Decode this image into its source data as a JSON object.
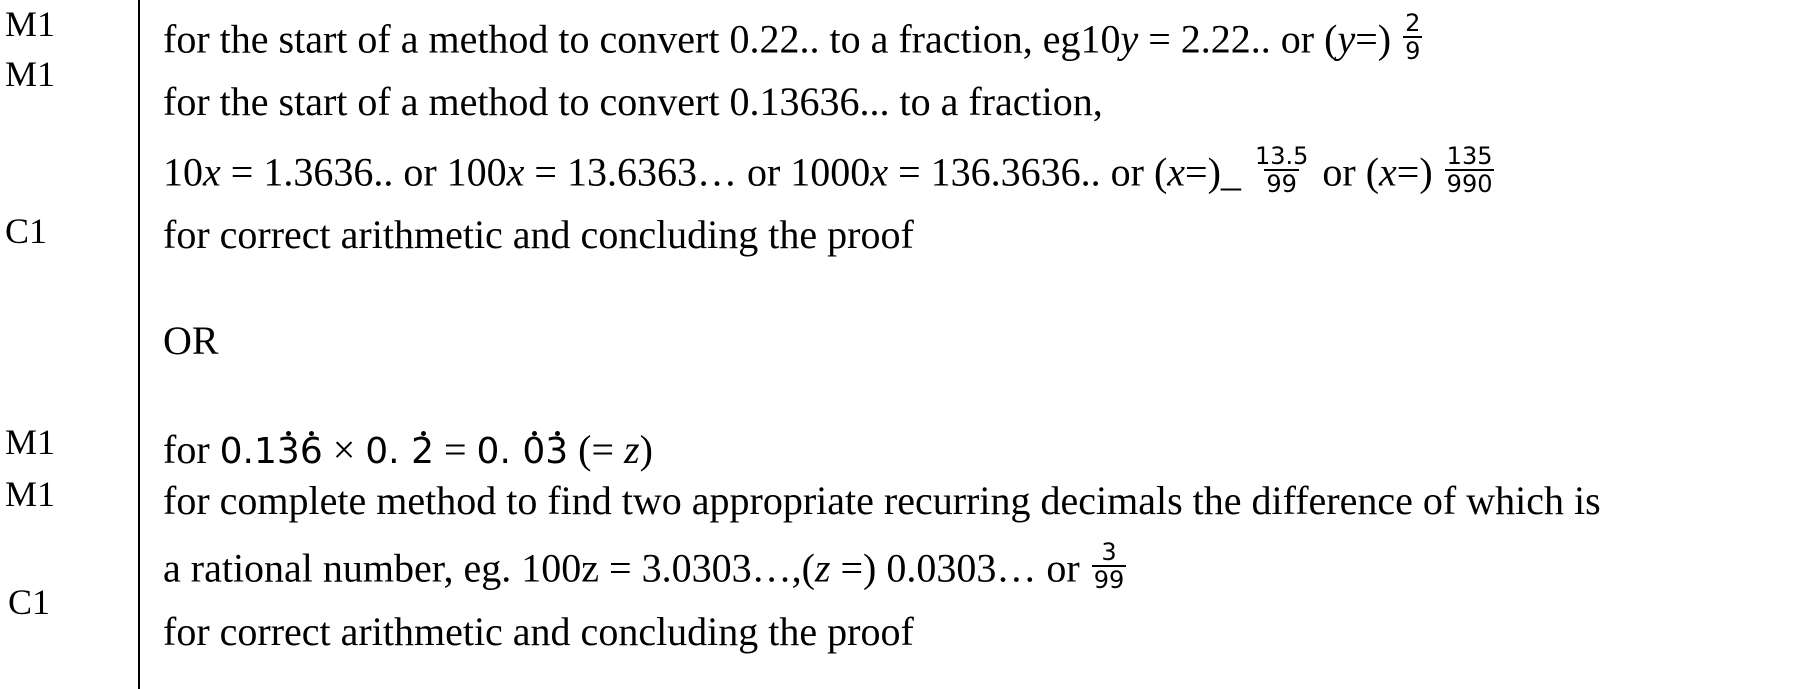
{
  "marks": [
    "M1",
    "M1",
    "C1",
    "M1",
    "M1",
    "C1"
  ],
  "lines": {
    "l1": {
      "text": "for the start of a method to convert 0.22.. to a fraction, eg10",
      "var": "y",
      "text2": " = 2.22.. or (",
      "var2": "y",
      "text3": "=)",
      "frac_num": "2",
      "frac_den": "9"
    },
    "l2": {
      "text": "for the start of a method to convert 0.13636...  to a fraction,"
    },
    "l3": {
      "a": "10",
      "v": "x",
      "b": " = 1.3636.. or 100",
      "c": " = 13.6363… or 1000",
      "d": " = 136.3636..  or (",
      "e": "=)_",
      "f1_num": "13.5",
      "f1_den": "99",
      "g": " or (",
      "h": "=)",
      "f2_num": "135",
      "f2_den": "990"
    },
    "l4": {
      "text": "for correct arithmetic and concluding the proof"
    },
    "or": "OR",
    "l5": {
      "text": "for ",
      "r1_a": "0.1",
      "r1_b": "3",
      "r1_c": "6",
      "times": " × ",
      "r2_a": "0. ",
      "r2_b": "2",
      "eq": " = ",
      "r3_a": "0. ",
      "r3_b": "0",
      "r3_c": "3",
      "tail": " (= ",
      "z": "z",
      "close": ")"
    },
    "l6": {
      "text": "for complete method to find two appropriate recurring decimals the difference of which is"
    },
    "l7": {
      "text": "a rational number, eg. 100z =  3.0303…,(",
      "z": "z",
      "text2": " =)  0.0303… or",
      "frac_num": "3",
      "frac_den": "99"
    },
    "l8": {
      "text": "for correct arithmetic and concluding the proof"
    }
  }
}
